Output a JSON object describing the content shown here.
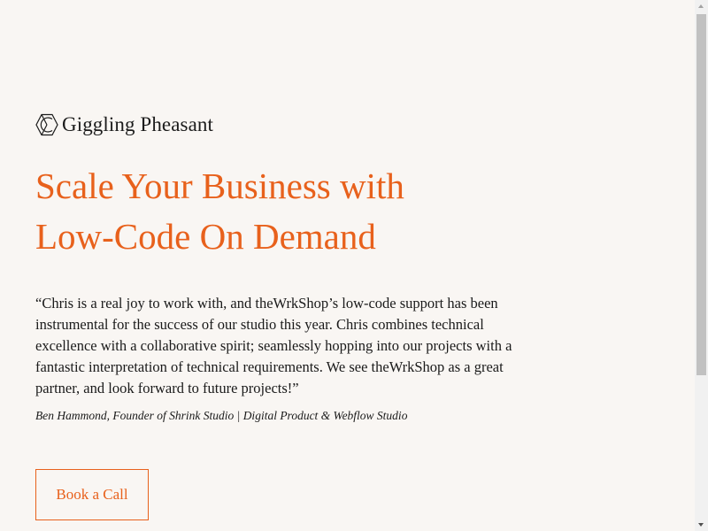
{
  "brand": {
    "name": "Giggling Pheasant",
    "logo_icon": "hexagon-c-logo-icon"
  },
  "hero": {
    "headline_line1": "Scale Your Business with",
    "headline_line2": "Low-Code On Demand"
  },
  "testimonial": {
    "quote": "“Chris is a real joy to work with, and theWrkShop’s low-code support has been instrumental for the success of our studio this year. Chris combines technical excellence with a collaborative spirit; seamlessly hopping into our projects with a fantastic interpretation of technical requirements. We see theWrkShop as a great partner, and look forward to future projects!”",
    "attribution": "Ben Hammond, Founder of Shrink Studio | Digital Product & Webflow Studio"
  },
  "cta": {
    "label": "Book a Call"
  },
  "colors": {
    "background": "#f9f6f3",
    "accent": "#e8611c",
    "text": "#1a1a1a"
  }
}
